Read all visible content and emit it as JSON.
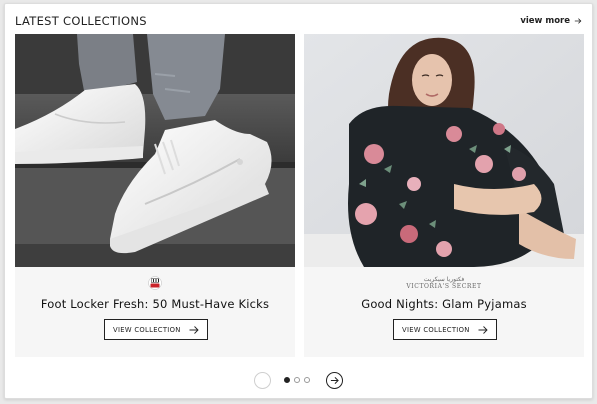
{
  "header": {
    "title": "LATEST COLLECTIONS",
    "view_more": "view more"
  },
  "cards": [
    {
      "title": "Foot Locker Fresh: 50 Must-Have Kicks",
      "button": "VIEW COLLECTION",
      "brand_logo": "foot-locker-logo",
      "image": "white-sneakers-on-steps"
    },
    {
      "title": "Good Nights: Glam Pyjamas",
      "button": "VIEW COLLECTION",
      "brand_logo": "victorias-secret-logo",
      "brand_ar": "فكتوريا سيكريت",
      "brand_en": "VICTORIA'S SECRET",
      "image": "woman-in-floral-pyjamas"
    }
  ],
  "pagination": {
    "pages": 3,
    "active_page": 1
  },
  "colors": {
    "text": "#1a1a1a",
    "card_bg": "#f6f6f6",
    "button_border": "#222222",
    "dot_active": "#222222",
    "dot_inactive_border": "#999999"
  }
}
